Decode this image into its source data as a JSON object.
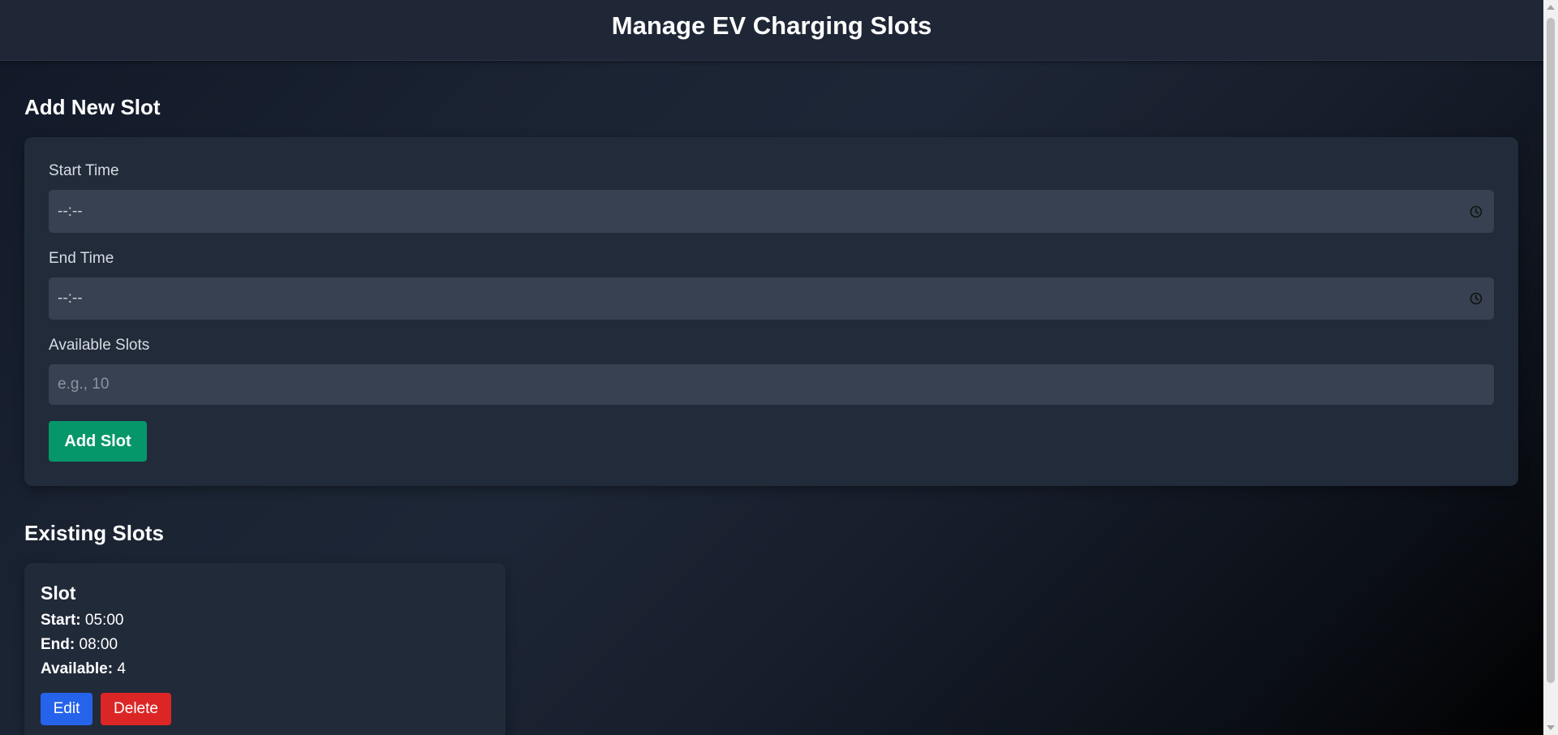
{
  "header": {
    "title": "Manage EV Charging Slots"
  },
  "add_section": {
    "title": "Add New Slot",
    "start_time": {
      "label": "Start Time",
      "value": "--:--"
    },
    "end_time": {
      "label": "End Time",
      "value": "--:--"
    },
    "available_slots": {
      "label": "Available Slots",
      "placeholder": "e.g., 10"
    },
    "submit_label": "Add Slot"
  },
  "existing_section": {
    "title": "Existing Slots",
    "slots": [
      {
        "heading": "Slot",
        "start_label": "Start:",
        "start_value": "05:00",
        "end_label": "End:",
        "end_value": "08:00",
        "available_label": "Available:",
        "available_value": "4",
        "edit_label": "Edit",
        "delete_label": "Delete"
      }
    ]
  },
  "colors": {
    "add_button": "#059669",
    "edit_button": "#2563eb",
    "delete_button": "#dc2626",
    "card": "#222b3a",
    "input": "#374151"
  },
  "icons": {
    "time_field": "clock-icon"
  }
}
